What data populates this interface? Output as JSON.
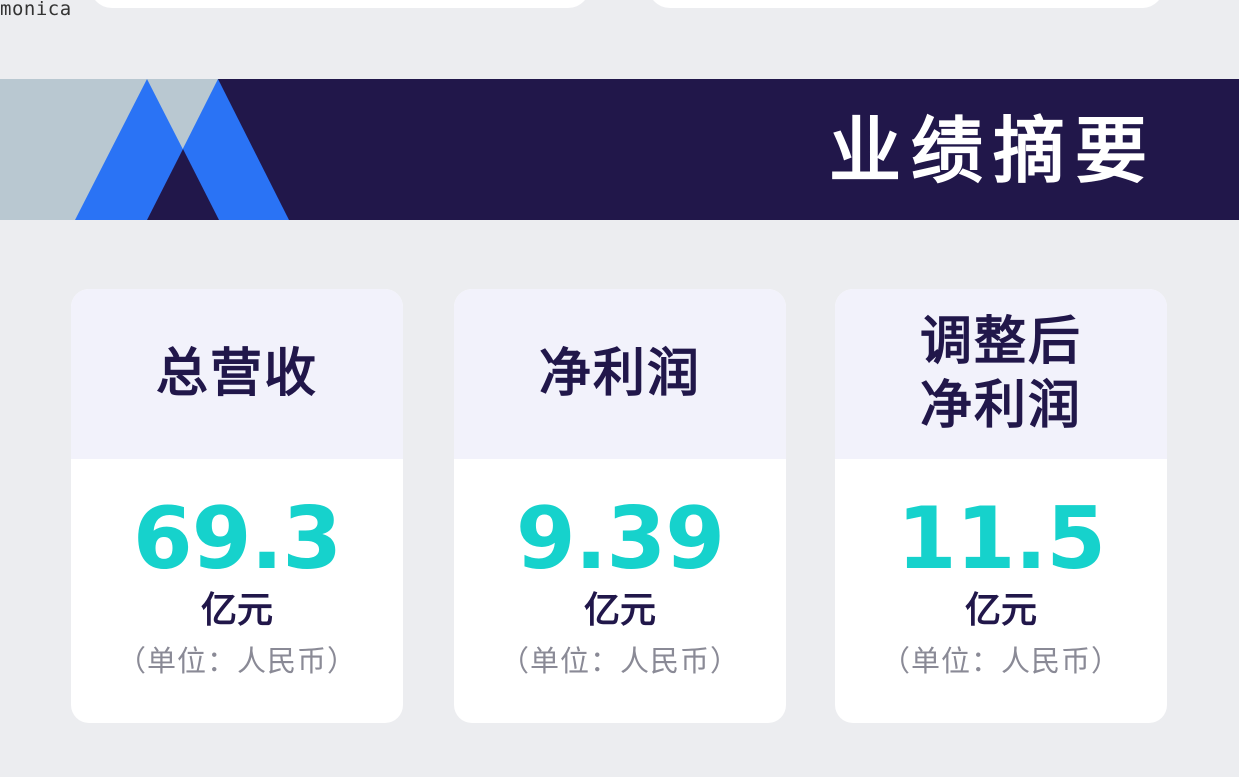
{
  "watermark": "monica",
  "banner": {
    "title": "业绩摘要",
    "colors": {
      "background": "#21174a",
      "logo_gray": "#b9c8d1",
      "logo_blue": "#2a73f5"
    }
  },
  "metrics": [
    {
      "title_lines": [
        "总营收"
      ],
      "value": "69.3",
      "unit": "亿元",
      "note": "（单位：人民币）"
    },
    {
      "title_lines": [
        "净利润"
      ],
      "value": "9.39",
      "unit": "亿元",
      "note": "（单位：人民币）"
    },
    {
      "title_lines": [
        "调整后",
        "净利润"
      ],
      "value": "11.5",
      "unit": "亿元",
      "note": "（单位：人民币）"
    }
  ],
  "colors": {
    "value": "#16d2cc",
    "title": "#21174a",
    "note": "#8a8a96",
    "card_head": "#f2f2fb",
    "page_bg": "#ecedf0"
  }
}
